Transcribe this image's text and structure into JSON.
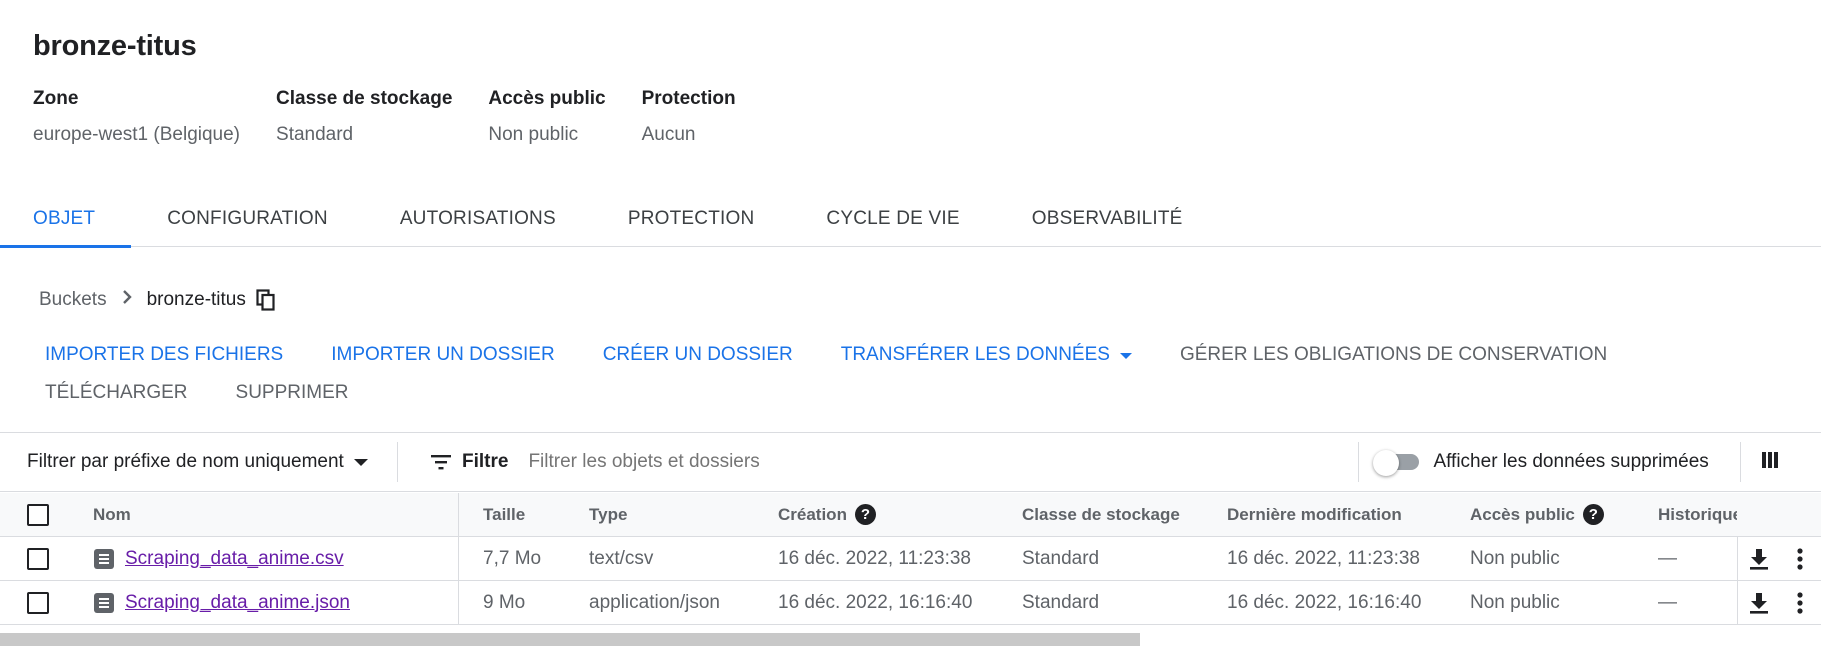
{
  "bucket": {
    "title": "bronze-titus",
    "properties": [
      {
        "label": "Zone",
        "value": "europe-west1 (Belgique)"
      },
      {
        "label": "Classe de stockage",
        "value": "Standard"
      },
      {
        "label": "Accès public",
        "value": "Non public"
      },
      {
        "label": "Protection",
        "value": "Aucun"
      }
    ]
  },
  "tabs": [
    {
      "label": "OBJET"
    },
    {
      "label": "CONFIGURATION"
    },
    {
      "label": "AUTORISATIONS"
    },
    {
      "label": "PROTECTION"
    },
    {
      "label": "CYCLE DE VIE"
    },
    {
      "label": "OBSERVABILITÉ"
    }
  ],
  "active_tab": "OBJET",
  "breadcrumb": {
    "root": "Buckets",
    "current": "bronze-titus"
  },
  "actions": {
    "upload_files": "IMPORTER DES FICHIERS",
    "upload_folder": "IMPORTER UN DOSSIER",
    "create_folder": "CRÉER UN DOSSIER",
    "transfer_data": "TRANSFÉRER LES DONNÉES",
    "manage_holds": "GÉRER LES OBLIGATIONS DE CONSERVATION",
    "download": "TÉLÉCHARGER",
    "delete": "SUPPRIMER"
  },
  "filter": {
    "prefix_select": "Filtrer par préfixe de nom uniquement",
    "filter_label": "Filtre",
    "placeholder": "Filtrer les objets et dossiers",
    "show_deleted_label": "Afficher les données supprimées",
    "show_deleted": false
  },
  "table": {
    "columns": {
      "name": "Nom",
      "size": "Taille",
      "type": "Type",
      "created": "Création",
      "storage_class": "Classe de stockage",
      "modified": "Dernière modification",
      "public_access": "Accès public",
      "history": "Historique"
    },
    "rows": [
      {
        "name": "Scraping_data_anime.csv",
        "size": "7,7 Mo",
        "type": "text/csv",
        "created": "16 déc. 2022, 11:23:38",
        "storage_class": "Standard",
        "modified": "16 déc. 2022, 11:23:38",
        "public_access": "Non public",
        "history": "—"
      },
      {
        "name": "Scraping_data_anime.json",
        "size": "9 Mo",
        "type": "application/json",
        "created": "16 déc. 2022, 16:16:40",
        "storage_class": "Standard",
        "modified": "16 déc. 2022, 16:16:40",
        "public_access": "Non public",
        "history": "—"
      }
    ]
  },
  "icons": {
    "breadcrumb_separator": "chevron-right-icon",
    "copy": "copy-icon",
    "filter": "filter-list-icon",
    "columns": "view-columns-icon",
    "help": "help-icon",
    "file": "file-icon",
    "download": "download-icon",
    "more": "more-vert-icon"
  },
  "colors": {
    "accent": "#1a73e8",
    "link_visited": "#681da8",
    "text_secondary": "#5f6368"
  }
}
